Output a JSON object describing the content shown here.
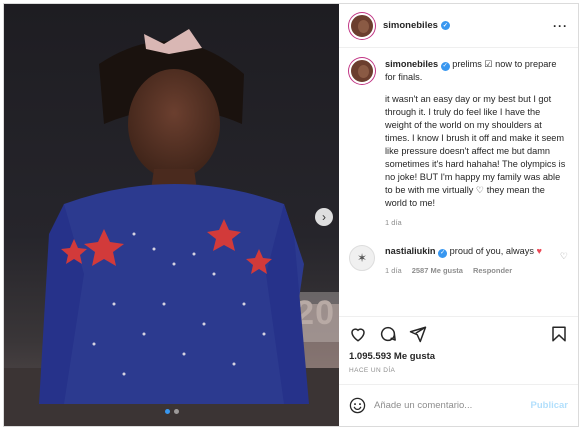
{
  "post": {
    "username": "simonebiles",
    "caption_lines": [
      "prelims ☑ now to prepare for finals.",
      "it wasn't an easy day or my best but I got through it. I truly do feel like I have the weight of the world on my shoulders at times. I know I brush it off and make it seem like pressure doesn't affect me but damn sometimes it's hard hahaha! The olympics is no joke! BUT I'm happy my family was able to be with me virtually",
      "♡ they mean the world to me!"
    ],
    "caption_time": "1 día",
    "image_overlay_text": "20",
    "likes": "1.095.593 Me gusta",
    "posted_ago": "HACE UN DÍA"
  },
  "comment": {
    "username": "nastialiukin",
    "text": "proud of you, always",
    "heart": "♥",
    "time": "1 día",
    "likes": "2587 Me gusta",
    "reply": "Responder"
  },
  "composer": {
    "placeholder": "Añade un comentario...",
    "post_label": "Publicar"
  },
  "icons": [
    "more-options-icon",
    "verified-icon",
    "heart-icon",
    "comment-icon",
    "share-icon",
    "save-icon",
    "emoji-icon",
    "next-arrow-icon",
    "small-heart-icon"
  ],
  "colors": {
    "verified": "#3897f0",
    "heart_red": "#ed4956",
    "post_disabled": "#b2dffc",
    "leotard": "#2c3a8f"
  }
}
